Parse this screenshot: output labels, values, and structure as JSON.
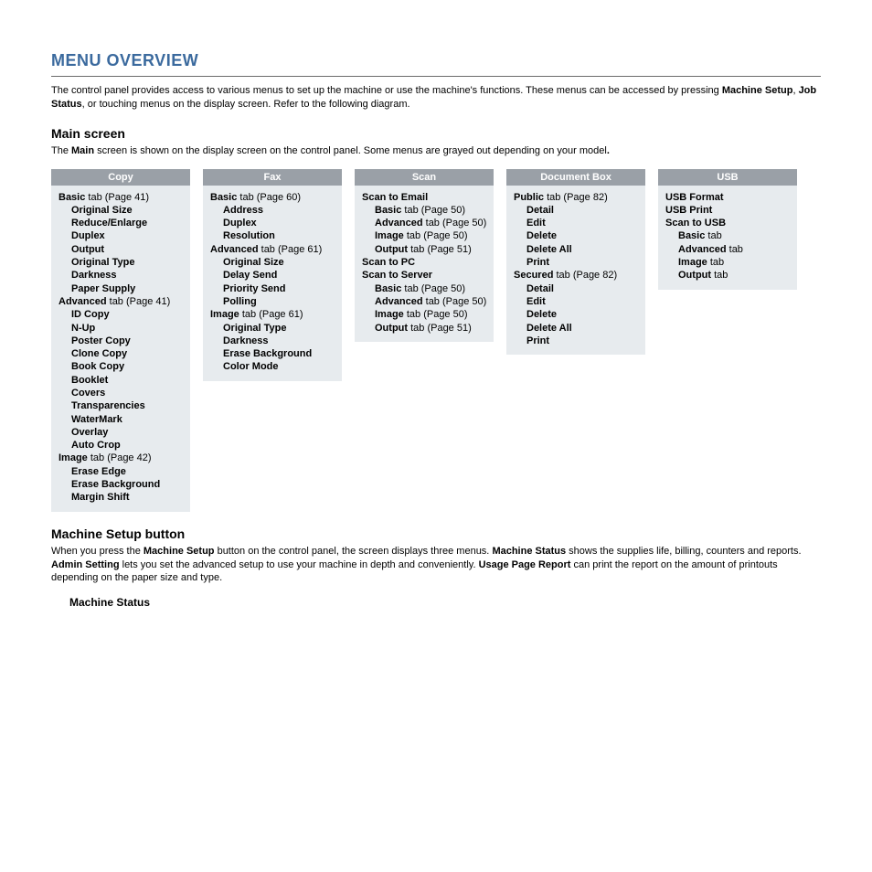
{
  "title": "MENU OVERVIEW",
  "intro_parts": [
    {
      "t": "The control panel provides access to various menus to set up the machine or use the machine's functions. These menus can be accessed by pressing "
    },
    {
      "t": "Machine Setup",
      "b": true
    },
    {
      "t": ", "
    },
    {
      "t": "Job Status",
      "b": true
    },
    {
      "t": ", or touching menus on the display screen. Refer to the following diagram."
    }
  ],
  "main_screen": {
    "heading": "Main screen",
    "text_parts": [
      {
        "t": "The "
      },
      {
        "t": "Main",
        "b": true
      },
      {
        "t": " screen is shown on the display screen on the control panel. Some menus are grayed out depending on your model"
      },
      {
        "t": ".",
        "b": true
      }
    ]
  },
  "columns": [
    {
      "header": "Copy",
      "items": [
        {
          "l": 0,
          "parts": [
            {
              "t": "Basic",
              "b": true
            },
            {
              "t": " tab (Page 41)"
            }
          ]
        },
        {
          "l": 1,
          "parts": [
            {
              "t": "Original Size",
              "b": true
            }
          ]
        },
        {
          "l": 1,
          "parts": [
            {
              "t": "Reduce/Enlarge",
              "b": true
            }
          ]
        },
        {
          "l": 1,
          "parts": [
            {
              "t": "Duplex",
              "b": true
            }
          ]
        },
        {
          "l": 1,
          "parts": [
            {
              "t": "Output",
              "b": true
            }
          ]
        },
        {
          "l": 1,
          "parts": [
            {
              "t": "Original Type",
              "b": true
            }
          ]
        },
        {
          "l": 1,
          "parts": [
            {
              "t": "Darkness",
              "b": true
            }
          ]
        },
        {
          "l": 1,
          "parts": [
            {
              "t": "Paper Supply",
              "b": true
            }
          ]
        },
        {
          "l": 0,
          "parts": [
            {
              "t": "Advanced",
              "b": true
            },
            {
              "t": " tab (Page 41)"
            }
          ]
        },
        {
          "l": 1,
          "parts": [
            {
              "t": "ID Copy",
              "b": true
            }
          ]
        },
        {
          "l": 1,
          "parts": [
            {
              "t": "N-Up",
              "b": true
            }
          ]
        },
        {
          "l": 1,
          "parts": [
            {
              "t": "Poster Copy",
              "b": true
            }
          ]
        },
        {
          "l": 1,
          "parts": [
            {
              "t": "Clone Copy",
              "b": true
            }
          ]
        },
        {
          "l": 1,
          "parts": [
            {
              "t": "Book Copy",
              "b": true
            }
          ]
        },
        {
          "l": 1,
          "parts": [
            {
              "t": "Booklet",
              "b": true
            }
          ]
        },
        {
          "l": 1,
          "parts": [
            {
              "t": "Covers",
              "b": true
            }
          ]
        },
        {
          "l": 1,
          "parts": [
            {
              "t": "Transparencies",
              "b": true
            }
          ]
        },
        {
          "l": 1,
          "parts": [
            {
              "t": "WaterMark",
              "b": true
            }
          ]
        },
        {
          "l": 1,
          "parts": [
            {
              "t": "Overlay",
              "b": true
            }
          ]
        },
        {
          "l": 1,
          "parts": [
            {
              "t": "Auto Crop",
              "b": true
            }
          ]
        },
        {
          "l": 0,
          "parts": [
            {
              "t": "Image",
              "b": true
            },
            {
              "t": " tab (Page 42)"
            }
          ]
        },
        {
          "l": 1,
          "parts": [
            {
              "t": "Erase Edge",
              "b": true
            }
          ]
        },
        {
          "l": 1,
          "parts": [
            {
              "t": "Erase Background",
              "b": true
            }
          ]
        },
        {
          "l": 1,
          "parts": [
            {
              "t": "Margin Shift",
              "b": true
            }
          ]
        }
      ]
    },
    {
      "header": "Fax",
      "items": [
        {
          "l": 0,
          "parts": [
            {
              "t": "Basic",
              "b": true
            },
            {
              "t": " tab (Page 60)"
            }
          ]
        },
        {
          "l": 1,
          "parts": [
            {
              "t": "Address",
              "b": true
            }
          ]
        },
        {
          "l": 1,
          "parts": [
            {
              "t": "Duplex",
              "b": true
            }
          ]
        },
        {
          "l": 1,
          "parts": [
            {
              "t": "Resolution",
              "b": true
            }
          ]
        },
        {
          "l": 0,
          "parts": [
            {
              "t": "Advanced",
              "b": true
            },
            {
              "t": " tab (Page 61)"
            }
          ]
        },
        {
          "l": 1,
          "parts": [
            {
              "t": "Original Size",
              "b": true
            }
          ]
        },
        {
          "l": 1,
          "parts": [
            {
              "t": "Delay Send",
              "b": true
            }
          ]
        },
        {
          "l": 1,
          "parts": [
            {
              "t": "Priority Send",
              "b": true
            }
          ]
        },
        {
          "l": 1,
          "parts": [
            {
              "t": "Polling",
              "b": true
            }
          ]
        },
        {
          "l": 0,
          "parts": [
            {
              "t": "Image",
              "b": true
            },
            {
              "t": " tab (Page 61)"
            }
          ]
        },
        {
          "l": 1,
          "parts": [
            {
              "t": "Original Type",
              "b": true
            }
          ]
        },
        {
          "l": 1,
          "parts": [
            {
              "t": "Darkness",
              "b": true
            }
          ]
        },
        {
          "l": 1,
          "parts": [
            {
              "t": "Erase Background",
              "b": true
            }
          ]
        },
        {
          "l": 1,
          "parts": [
            {
              "t": "Color Mode",
              "b": true
            }
          ]
        }
      ]
    },
    {
      "header": "Scan",
      "items": [
        {
          "l": 0,
          "parts": [
            {
              "t": "Scan to Email",
              "b": true
            }
          ]
        },
        {
          "l": 1,
          "parts": [
            {
              "t": "Basic",
              "b": true
            },
            {
              "t": " tab (Page 50)"
            }
          ]
        },
        {
          "l": 1,
          "parts": [
            {
              "t": "Advanced",
              "b": true
            },
            {
              "t": " tab (Page 50)"
            }
          ]
        },
        {
          "l": 1,
          "parts": [
            {
              "t": "Image",
              "b": true
            },
            {
              "t": " tab (Page 50)"
            }
          ]
        },
        {
          "l": 1,
          "parts": [
            {
              "t": "Output",
              "b": true
            },
            {
              "t": " tab (Page 51)"
            }
          ]
        },
        {
          "l": 0,
          "parts": [
            {
              "t": "Scan to PC",
              "b": true
            }
          ]
        },
        {
          "l": 0,
          "parts": [
            {
              "t": "Scan to Server",
              "b": true
            }
          ]
        },
        {
          "l": 1,
          "parts": [
            {
              "t": "Basic",
              "b": true
            },
            {
              "t": " tab (Page 50)"
            }
          ]
        },
        {
          "l": 1,
          "parts": [
            {
              "t": "Advanced",
              "b": true
            },
            {
              "t": " tab (Page 50)"
            }
          ]
        },
        {
          "l": 1,
          "parts": [
            {
              "t": "Image",
              "b": true
            },
            {
              "t": " tab (Page 50)"
            }
          ]
        },
        {
          "l": 1,
          "parts": [
            {
              "t": "Output",
              "b": true
            },
            {
              "t": " tab (Page 51)"
            }
          ]
        }
      ]
    },
    {
      "header": "Document Box",
      "items": [
        {
          "l": 0,
          "parts": [
            {
              "t": "Public",
              "b": true
            },
            {
              "t": " tab (Page 82)"
            }
          ]
        },
        {
          "l": 1,
          "parts": [
            {
              "t": "Detail",
              "b": true
            }
          ]
        },
        {
          "l": 1,
          "parts": [
            {
              "t": "Edit",
              "b": true
            }
          ]
        },
        {
          "l": 1,
          "parts": [
            {
              "t": "Delete",
              "b": true
            }
          ]
        },
        {
          "l": 1,
          "parts": [
            {
              "t": "Delete All",
              "b": true
            }
          ]
        },
        {
          "l": 1,
          "parts": [
            {
              "t": "Print",
              "b": true
            }
          ]
        },
        {
          "l": 0,
          "parts": [
            {
              "t": "Secured",
              "b": true
            },
            {
              "t": " tab (Page 82)"
            }
          ]
        },
        {
          "l": 1,
          "parts": [
            {
              "t": "Detail",
              "b": true
            }
          ]
        },
        {
          "l": 1,
          "parts": [
            {
              "t": "Edit",
              "b": true
            }
          ]
        },
        {
          "l": 1,
          "parts": [
            {
              "t": "Delete",
              "b": true
            }
          ]
        },
        {
          "l": 1,
          "parts": [
            {
              "t": "Delete All",
              "b": true
            }
          ]
        },
        {
          "l": 1,
          "parts": [
            {
              "t": "Print",
              "b": true
            }
          ]
        }
      ]
    },
    {
      "header": "USB",
      "items": [
        {
          "l": 0,
          "parts": [
            {
              "t": "USB Format",
              "b": true
            }
          ]
        },
        {
          "l": 0,
          "parts": [
            {
              "t": "USB Print",
              "b": true
            }
          ]
        },
        {
          "l": 0,
          "parts": [
            {
              "t": "Scan to USB",
              "b": true
            }
          ]
        },
        {
          "l": 1,
          "parts": [
            {
              "t": "Basic",
              "b": true
            },
            {
              "t": " tab"
            }
          ]
        },
        {
          "l": 1,
          "parts": [
            {
              "t": "Advanced",
              "b": true
            },
            {
              "t": " tab"
            }
          ]
        },
        {
          "l": 1,
          "parts": [
            {
              "t": "Image",
              "b": true
            },
            {
              "t": " tab"
            }
          ]
        },
        {
          "l": 1,
          "parts": [
            {
              "t": "Output",
              "b": true
            },
            {
              "t": " tab"
            }
          ]
        }
      ]
    }
  ],
  "machine_setup": {
    "heading": "Machine Setup button",
    "text_parts": [
      {
        "t": "When you press the "
      },
      {
        "t": "Machine Setup",
        "b": true
      },
      {
        "t": " button on the control panel, the screen displays three menus. "
      },
      {
        "t": "Machine Status",
        "b": true
      },
      {
        "t": " shows the supplies life, billing, counters and reports. "
      },
      {
        "t": "Admin Setting",
        "b": true
      },
      {
        "t": " lets you set the advanced setup to use your machine in depth and conveniently. "
      },
      {
        "t": "Usage Page Report",
        "b": true
      },
      {
        "t": " can print the report on the amount of printouts depending on the paper size and type."
      }
    ],
    "sub_heading": "Machine Status"
  }
}
